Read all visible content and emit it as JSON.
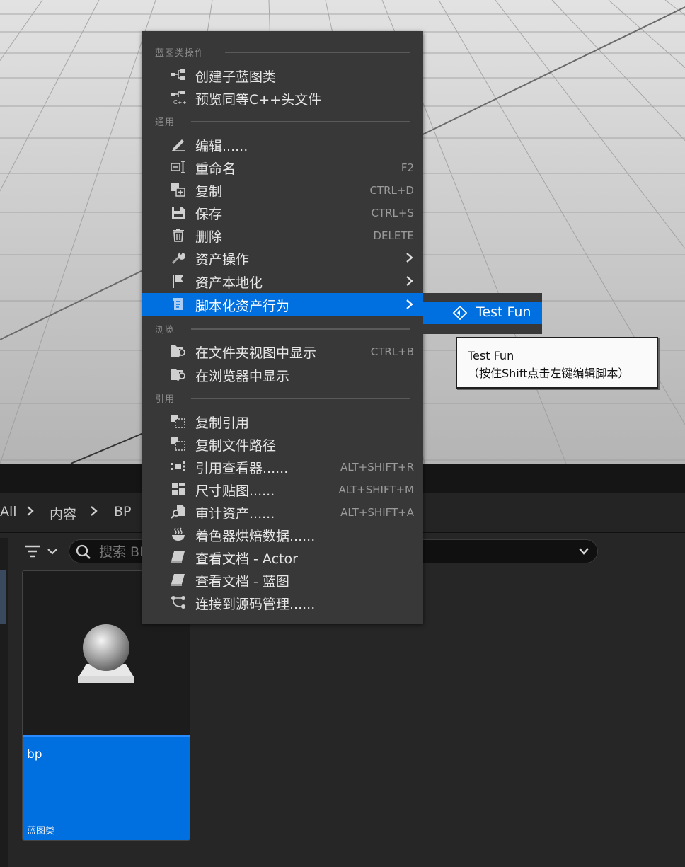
{
  "menu": {
    "sections": [
      {
        "label": "蓝图类操作"
      },
      {
        "label": "通用"
      },
      {
        "label": "浏览"
      },
      {
        "label": "引用"
      }
    ],
    "items": [
      {
        "label": "创建子蓝图类",
        "shortcut": "",
        "icon": "child-blueprint-icon"
      },
      {
        "label": "预览同等C++头文件",
        "shortcut": "",
        "icon": "cpp-header-icon"
      },
      {
        "label": "编辑......",
        "shortcut": "",
        "icon": "edit-pencil-icon"
      },
      {
        "label": "重命名",
        "shortcut": "F2",
        "icon": "rename-icon"
      },
      {
        "label": "复制",
        "shortcut": "CTRL+D",
        "icon": "duplicate-icon"
      },
      {
        "label": "保存",
        "shortcut": "CTRL+S",
        "icon": "save-icon"
      },
      {
        "label": "删除",
        "shortcut": "DELETE",
        "icon": "trash-icon"
      },
      {
        "label": "资产操作",
        "shortcut": "",
        "icon": "wrench-icon"
      },
      {
        "label": "资产本地化",
        "shortcut": "",
        "icon": "flag-icon"
      },
      {
        "label": "脚本化资产行为",
        "shortcut": "",
        "icon": "script-icon"
      },
      {
        "label": "在文件夹视图中显示",
        "shortcut": "CTRL+B",
        "icon": "folder-search-icon"
      },
      {
        "label": "在浏览器中显示",
        "shortcut": "",
        "icon": "folder-search-icon"
      },
      {
        "label": "复制引用",
        "shortcut": "",
        "icon": "copy-reference-icon"
      },
      {
        "label": "复制文件路径",
        "shortcut": "",
        "icon": "copy-path-icon"
      },
      {
        "label": "引用查看器......",
        "shortcut": "ALT+SHIFT+R",
        "icon": "reference-viewer-icon"
      },
      {
        "label": "尺寸贴图......",
        "shortcut": "ALT+SHIFT+M",
        "icon": "size-map-icon"
      },
      {
        "label": "审计资产......",
        "shortcut": "ALT+SHIFT+A",
        "icon": "audit-icon"
      },
      {
        "label": "着色器烘焙数据......",
        "shortcut": "",
        "icon": "shader-cook-icon"
      },
      {
        "label": "查看文档 - Actor",
        "shortcut": "",
        "icon": "documentation-icon"
      },
      {
        "label": "查看文档 - 蓝图",
        "shortcut": "",
        "icon": "documentation-icon"
      },
      {
        "label": "连接到源码管理......",
        "shortcut": "",
        "icon": "source-control-icon"
      }
    ]
  },
  "submenu": {
    "item_label": "Test Fun",
    "icon": "scripted-action-icon"
  },
  "tooltip": {
    "title": "Test Fun",
    "hint": "（按住Shift点击左键编辑脚本）"
  },
  "breadcrumb": {
    "items": [
      "All",
      "内容",
      "BP"
    ]
  },
  "search": {
    "placeholder": "搜索 BP"
  },
  "asset": {
    "name": "bp",
    "type": "蓝图类"
  },
  "colors": {
    "highlight": "#0070e0",
    "menu_bg": "#383838",
    "asset_info_bg": "#0070e0"
  }
}
